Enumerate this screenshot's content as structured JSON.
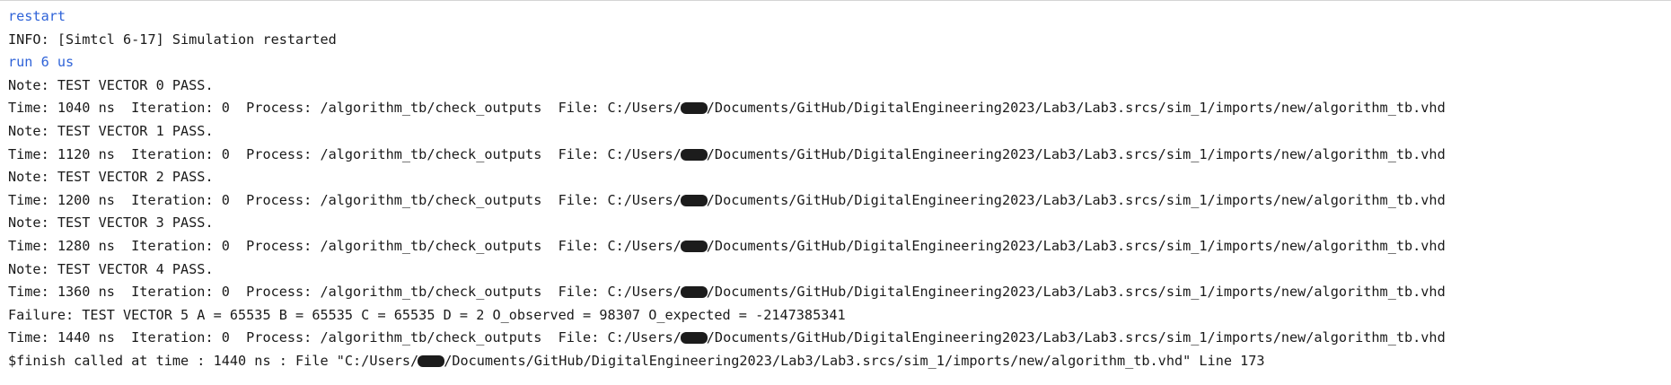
{
  "console": {
    "lines": [
      {
        "type": "cmd",
        "text": "restart"
      },
      {
        "type": "out",
        "text": "INFO: [Simtcl 6-17] Simulation restarted"
      },
      {
        "type": "cmd",
        "text": "run 6 us"
      },
      {
        "type": "out",
        "text": "Note: TEST VECTOR 0 PASS."
      },
      {
        "type": "out",
        "pre": "Time: 1040 ns  Iteration: 0  Process: /algorithm_tb/check_outputs  File: C:/Users/",
        "post": "/Documents/GitHub/DigitalEngineering2023/Lab3/Lab3.srcs/sim_1/imports/new/algorithm_tb.vhd"
      },
      {
        "type": "out",
        "text": "Note: TEST VECTOR 1 PASS."
      },
      {
        "type": "out",
        "pre": "Time: 1120 ns  Iteration: 0  Process: /algorithm_tb/check_outputs  File: C:/Users/",
        "post": "/Documents/GitHub/DigitalEngineering2023/Lab3/Lab3.srcs/sim_1/imports/new/algorithm_tb.vhd"
      },
      {
        "type": "out",
        "text": "Note: TEST VECTOR 2 PASS."
      },
      {
        "type": "out",
        "pre": "Time: 1200 ns  Iteration: 0  Process: /algorithm_tb/check_outputs  File: C:/Users/",
        "post": "/Documents/GitHub/DigitalEngineering2023/Lab3/Lab3.srcs/sim_1/imports/new/algorithm_tb.vhd"
      },
      {
        "type": "out",
        "text": "Note: TEST VECTOR 3 PASS."
      },
      {
        "type": "out",
        "pre": "Time: 1280 ns  Iteration: 0  Process: /algorithm_tb/check_outputs  File: C:/Users/",
        "post": "/Documents/GitHub/DigitalEngineering2023/Lab3/Lab3.srcs/sim_1/imports/new/algorithm_tb.vhd"
      },
      {
        "type": "out",
        "text": "Note: TEST VECTOR 4 PASS."
      },
      {
        "type": "out",
        "pre": "Time: 1360 ns  Iteration: 0  Process: /algorithm_tb/check_outputs  File: C:/Users/",
        "post": "/Documents/GitHub/DigitalEngineering2023/Lab3/Lab3.srcs/sim_1/imports/new/algorithm_tb.vhd"
      },
      {
        "type": "out",
        "text": "Failure: TEST VECTOR 5 A = 65535 B = 65535 C = 65535 D = 2 O_observed = 98307 O_expected = -2147385341"
      },
      {
        "type": "out",
        "pre": "Time: 1440 ns  Iteration: 0  Process: /algorithm_tb/check_outputs  File: C:/Users/",
        "post": "/Documents/GitHub/DigitalEngineering2023/Lab3/Lab3.srcs/sim_1/imports/new/algorithm_tb.vhd"
      },
      {
        "type": "out",
        "pre": "$finish called at time : 1440 ns : File \"C:/Users/",
        "post": "/Documents/GitHub/DigitalEngineering2023/Lab3/Lab3.srcs/sim_1/imports/new/algorithm_tb.vhd\" Line 173"
      }
    ]
  }
}
